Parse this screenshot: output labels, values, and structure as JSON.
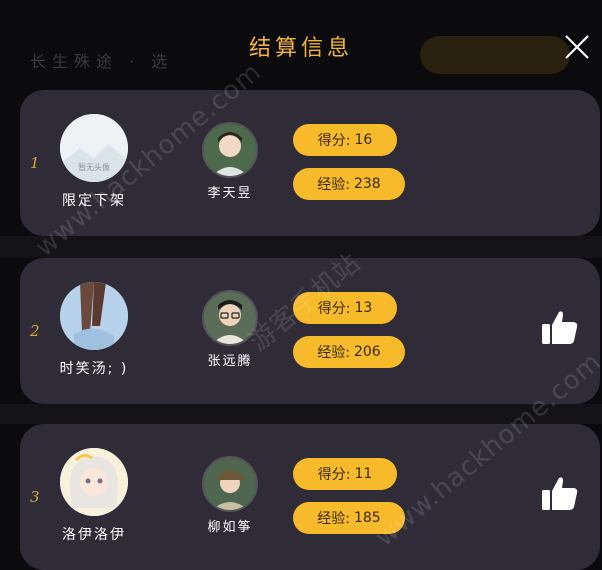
{
  "header": {
    "title": "结算信息",
    "bg_label": "长生殊途 · 选"
  },
  "results": [
    {
      "rank": "1",
      "player_name": "限定下架",
      "avatar_text": "暂无头像",
      "character_name": "李天昱",
      "score_label": "得分:",
      "score_value": "16",
      "exp_label": "经验:",
      "exp_value": "238",
      "liked": false
    },
    {
      "rank": "2",
      "player_name": "时笑汤; )",
      "character_name": "张远腾",
      "score_label": "得分:",
      "score_value": "13",
      "exp_label": "经验:",
      "exp_value": "206",
      "liked": true
    },
    {
      "rank": "3",
      "player_name": "洛伊洛伊",
      "character_name": "柳如筝",
      "score_label": "得分:",
      "score_value": "11",
      "exp_label": "经验:",
      "exp_value": "185",
      "liked": true
    }
  ],
  "watermarks": {
    "left": "www.hackhome.com",
    "center": "游客手机站",
    "right": "www.hackhome.com"
  },
  "colors": {
    "accent": "#f7ba2a",
    "card": "#2f2c37",
    "title": "#f2b43a"
  }
}
